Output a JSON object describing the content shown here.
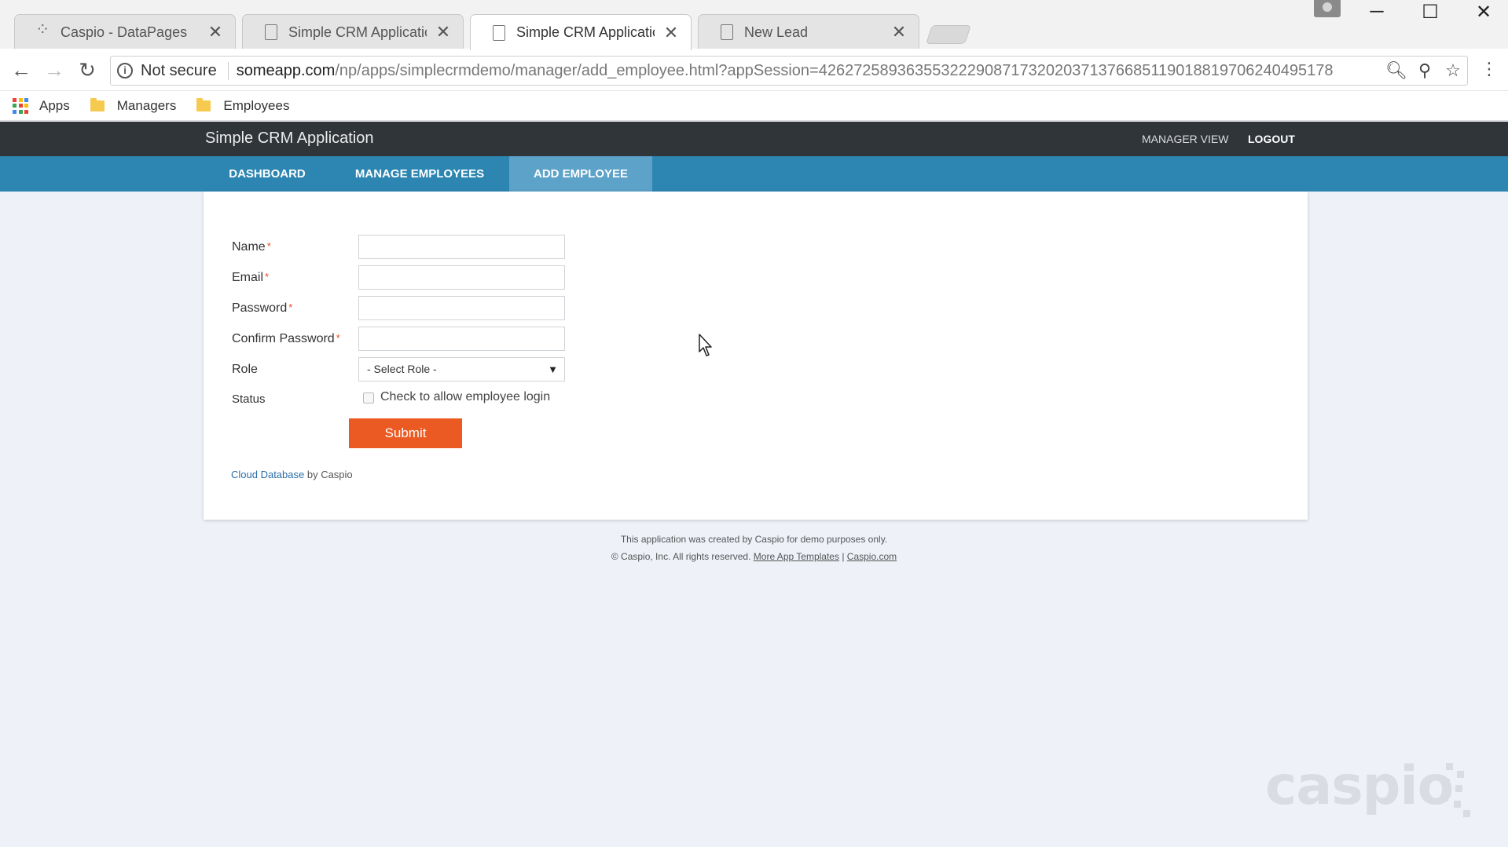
{
  "browser": {
    "tabs": [
      {
        "title": "Caspio - DataPages",
        "active": false,
        "icon": "caspio-icon"
      },
      {
        "title": "Simple CRM Application",
        "active": false,
        "icon": "page-icon"
      },
      {
        "title": "Simple CRM Application",
        "active": true,
        "icon": "page-icon"
      },
      {
        "title": "New Lead",
        "active": false,
        "icon": "page-icon"
      }
    ],
    "tab_close": "✕",
    "security_label": "Not secure",
    "url_host": "someapp.com",
    "url_path": "/np/apps/simplecrmdemo/manager/add_employee.html?appSession=42627258936355322290871732020371376685119018819706240495178",
    "bookmarks": {
      "apps": "Apps",
      "folders": [
        "Managers",
        "Employees"
      ]
    },
    "window_controls": {
      "minimize": "─",
      "maximize": "☐",
      "close": "✕"
    }
  },
  "app": {
    "title": "Simple CRM Application",
    "header_links": [
      "MANAGER VIEW",
      "LOGOUT"
    ],
    "nav": [
      "DASHBOARD",
      "MANAGE EMPLOYEES",
      "ADD EMPLOYEE"
    ],
    "active_nav": "ADD EMPLOYEE"
  },
  "form": {
    "fields": [
      {
        "label": "Name",
        "required": true,
        "value": ""
      },
      {
        "label": "Email",
        "required": true,
        "value": ""
      },
      {
        "label": "Password",
        "required": true,
        "value": ""
      },
      {
        "label": "Confirm Password",
        "required": true,
        "value": ""
      }
    ],
    "required_mark": "*",
    "role_label": "Role",
    "role_selected": "- Select Role -",
    "status_label": "Status",
    "status_checkbox_label": "Check to allow employee login",
    "status_checked": false,
    "submit_label": "Submit",
    "powered_link": "Cloud Database",
    "powered_text": " by Caspio"
  },
  "footer": {
    "line1": "This application was created by Caspio for demo purposes only.",
    "line2_prefix": "© Caspio, Inc. All rights reserved.",
    "link1": "More App Templates",
    "separator": "|",
    "link2": "Caspio.com"
  },
  "watermark": "caspio",
  "colors": {
    "header_bg": "#30353a",
    "nav_bg": "#2d86b2",
    "nav_active_bg": "#5da2c9",
    "submit_bg": "#ec5a24",
    "required": "#e34e1c"
  }
}
